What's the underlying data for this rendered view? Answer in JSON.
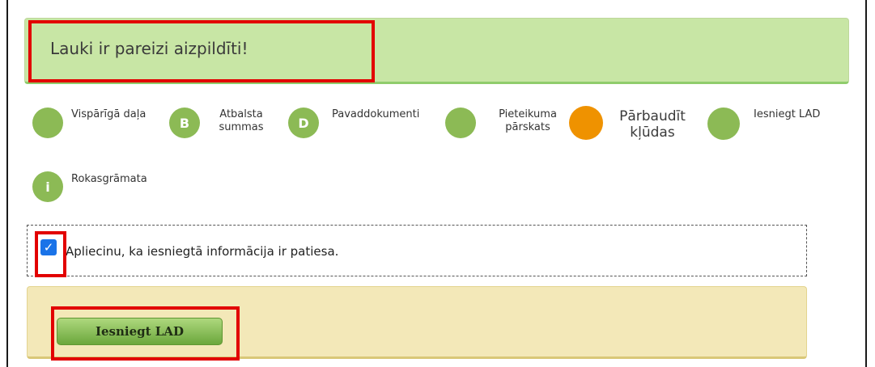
{
  "banner": {
    "message": "Lauki ir pareizi aizpildīti!"
  },
  "steps": [
    {
      "badge": "",
      "label": "Vispārīgā daļa",
      "color": "#8cba55"
    },
    {
      "badge": "B",
      "label": "Atbalsta\nsummas",
      "color": "#8cba55"
    },
    {
      "badge": "D",
      "label": "Pavaddokumenti",
      "color": "#8cba55"
    },
    {
      "badge": "",
      "label": "Pieteikuma\npārskats",
      "color": "#8cba55"
    },
    {
      "badge": "",
      "label": "Pārbaudīt\nkļūdas",
      "color": "#ef9200"
    },
    {
      "badge": "",
      "label": "Iesniegt LAD",
      "color": "#8cba55"
    },
    {
      "badge": "i",
      "label": "Rokasgrāmata",
      "color": "#8cba55"
    }
  ],
  "confirmation": {
    "checked": true,
    "text": "Apliecinu, ka iesniegtā informācija ir patiesa."
  },
  "submit": {
    "label": "Iesniegt LAD"
  },
  "colors": {
    "highlight": "#e20000",
    "success_bg": "#c8e6a5",
    "submit_panel_bg": "#f3e8b8"
  }
}
